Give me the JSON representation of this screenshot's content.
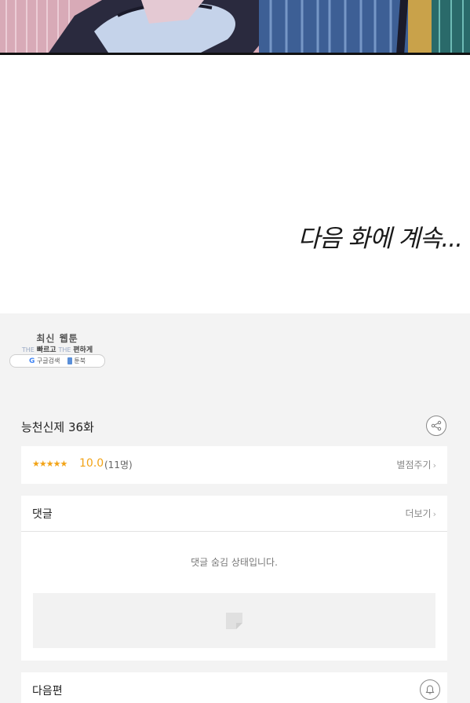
{
  "comic": {
    "continued_text": "다음 화에 계속..."
  },
  "watermark": {
    "title": "최신 웹툰",
    "subtitle_the1": "THE",
    "subtitle_fast": "빠르고",
    "subtitle_the2": "THE",
    "subtitle_easy": "편하게",
    "google_label": "구글검색",
    "book_label": "툰북"
  },
  "episode": {
    "title": "능천신제 36화",
    "share_icon": "share-icon"
  },
  "rating": {
    "stars": "★★★★★",
    "score": "10.0",
    "count": "(11명)",
    "rate_link": "별점주기",
    "chevron": "›"
  },
  "comments": {
    "title": "댓글",
    "more_link": "더보기",
    "chevron": "›",
    "hidden_message": "댓글 숨김 상태입니다."
  },
  "next": {
    "title": "다음편",
    "bell_icon": "bell-icon"
  },
  "colors": {
    "accent_star": "#f2a316",
    "background": "#f3f3f3",
    "card": "#ffffff"
  }
}
